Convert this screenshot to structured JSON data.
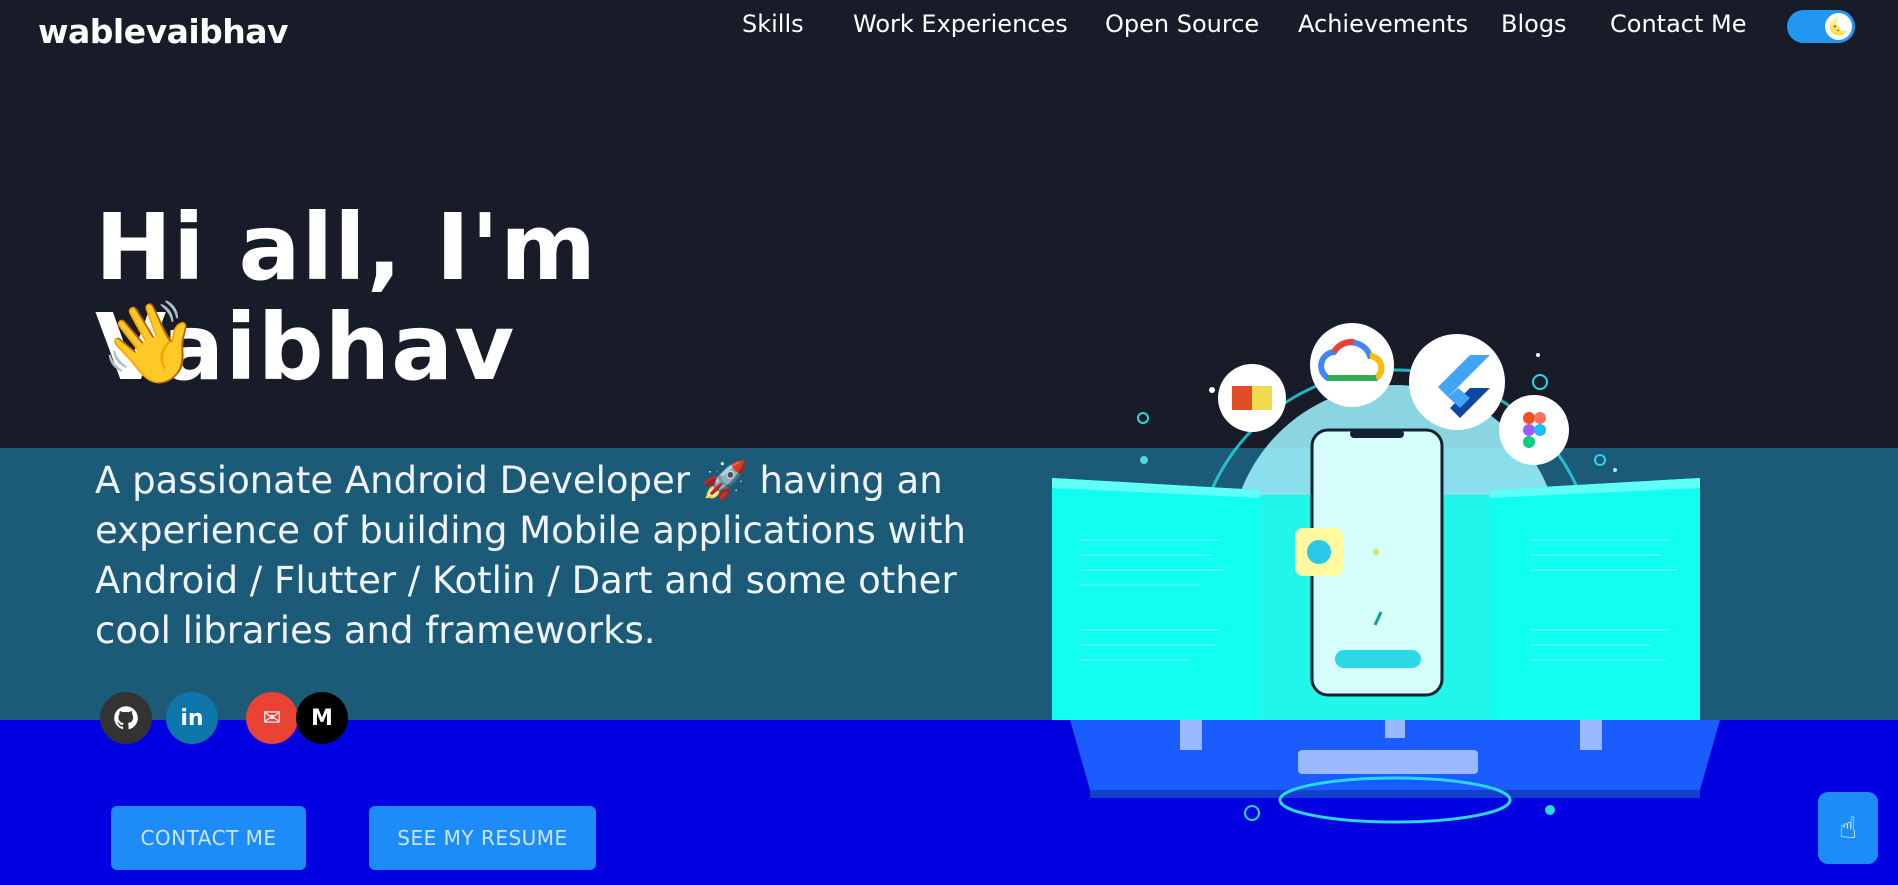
{
  "header": {
    "logo": "wablevaibhav",
    "nav": [
      {
        "label": "Skills"
      },
      {
        "label": "Work Experiences"
      },
      {
        "label": "Open Source"
      },
      {
        "label": "Achievements"
      },
      {
        "label": "Blogs"
      },
      {
        "label": "Contact Me"
      }
    ],
    "theme_toggle_icon": "moon-icon"
  },
  "hero": {
    "greeting": "Hi all, I'm Vaibhav",
    "wave_emoji": "👋",
    "subtitle": "A passionate Android Developer 🚀 having an experience of building Mobile applications with Android / Flutter / Kotlin / Dart and some other cool libraries and frameworks.",
    "social": [
      {
        "name": "github-icon",
        "glyph": "⌥",
        "color": "#333333"
      },
      {
        "name": "linkedin-icon",
        "glyph": "in",
        "color": "#0e76a8"
      },
      {
        "name": "email-icon",
        "glyph": "✉",
        "color": "#ea4335"
      },
      {
        "name": "medium-icon",
        "glyph": "M",
        "color": "#000000"
      }
    ],
    "buttons": {
      "contact": "CONTACT ME",
      "resume": "SEE MY RESUME"
    }
  },
  "colors": {
    "background": "#171c28",
    "teal_band": "#1b5b78",
    "blue_band": "#0000e0",
    "accent": "#1d8cf8"
  },
  "illustration": {
    "icons": [
      "javascript-icon",
      "google-cloud-icon",
      "flutter-icon",
      "figma-icon"
    ]
  }
}
